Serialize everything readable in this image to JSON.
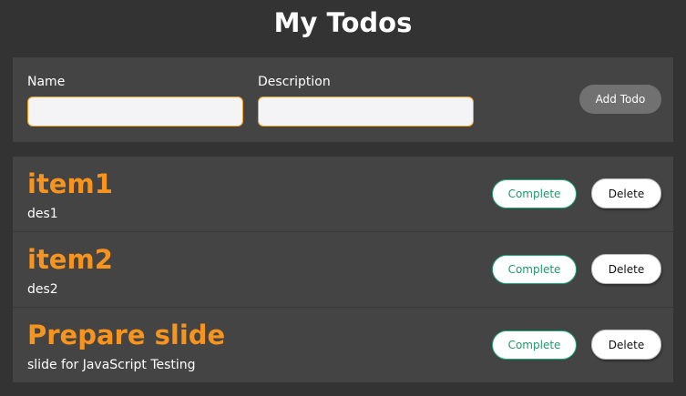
{
  "page": {
    "title": "My Todos"
  },
  "form": {
    "name_label": "Name",
    "name_value": "",
    "name_placeholder": "",
    "description_label": "Description",
    "description_value": "",
    "description_placeholder": "",
    "add_button_label": "Add Todo"
  },
  "todos": [
    {
      "name": "item1",
      "description": "des1",
      "complete_label": "Complete",
      "delete_label": "Delete"
    },
    {
      "name": "item2",
      "description": "des2",
      "complete_label": "Complete",
      "delete_label": "Delete"
    },
    {
      "name": "Prepare slide",
      "description": "slide for JavaScript Testing",
      "complete_label": "Complete",
      "delete_label": "Delete"
    }
  ],
  "colors": {
    "background": "#333333",
    "panel": "#444444",
    "accent": "#f7941d",
    "complete": "#1a9a6c",
    "input_border": "#f0a020",
    "add_button": "#717171"
  }
}
